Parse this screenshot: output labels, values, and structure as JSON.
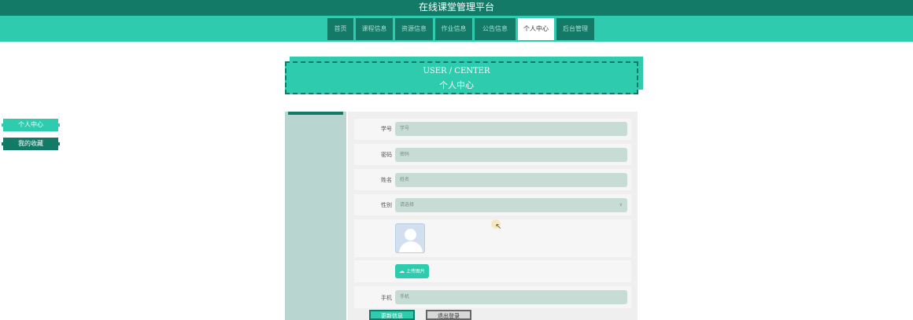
{
  "app": {
    "title": "在线课堂管理平台"
  },
  "nav": {
    "items": [
      {
        "label": "首页",
        "active": false
      },
      {
        "label": "课程信息",
        "active": false
      },
      {
        "label": "资源信息",
        "active": false
      },
      {
        "label": "作业信息",
        "active": false
      },
      {
        "label": "公告信息",
        "active": false
      },
      {
        "label": "个人中心",
        "active": true
      },
      {
        "label": "后台管理",
        "active": false
      }
    ]
  },
  "header": {
    "title_en": "USER / CENTER",
    "title_cn": "个人中心"
  },
  "sidebar": {
    "items": [
      {
        "label": "个人中心",
        "active": true
      },
      {
        "label": "我的收藏",
        "active": false
      }
    ]
  },
  "form": {
    "student_id": {
      "label": "学号",
      "placeholder": "学号"
    },
    "password": {
      "label": "密码",
      "placeholder": "密码"
    },
    "name": {
      "label": "姓名",
      "placeholder": "姓名"
    },
    "gender": {
      "label": "性别",
      "value": "请选择"
    },
    "upload_label": "上传图片",
    "phone": {
      "label": "手机",
      "placeholder": "手机"
    }
  },
  "buttons": {
    "save": "更新信息",
    "logout": "退出登录"
  },
  "colors": {
    "brand_dark": "#127a66",
    "brand": "#2ecbae",
    "input_bg": "#c8dcd6",
    "sidebar_bg": "#b9d5cf"
  },
  "icons": {
    "upload": "cloud-upload-icon",
    "avatar": "avatar-placeholder-icon",
    "select": "chevron-down-icon",
    "cursor": "mouse-pointer-icon"
  }
}
